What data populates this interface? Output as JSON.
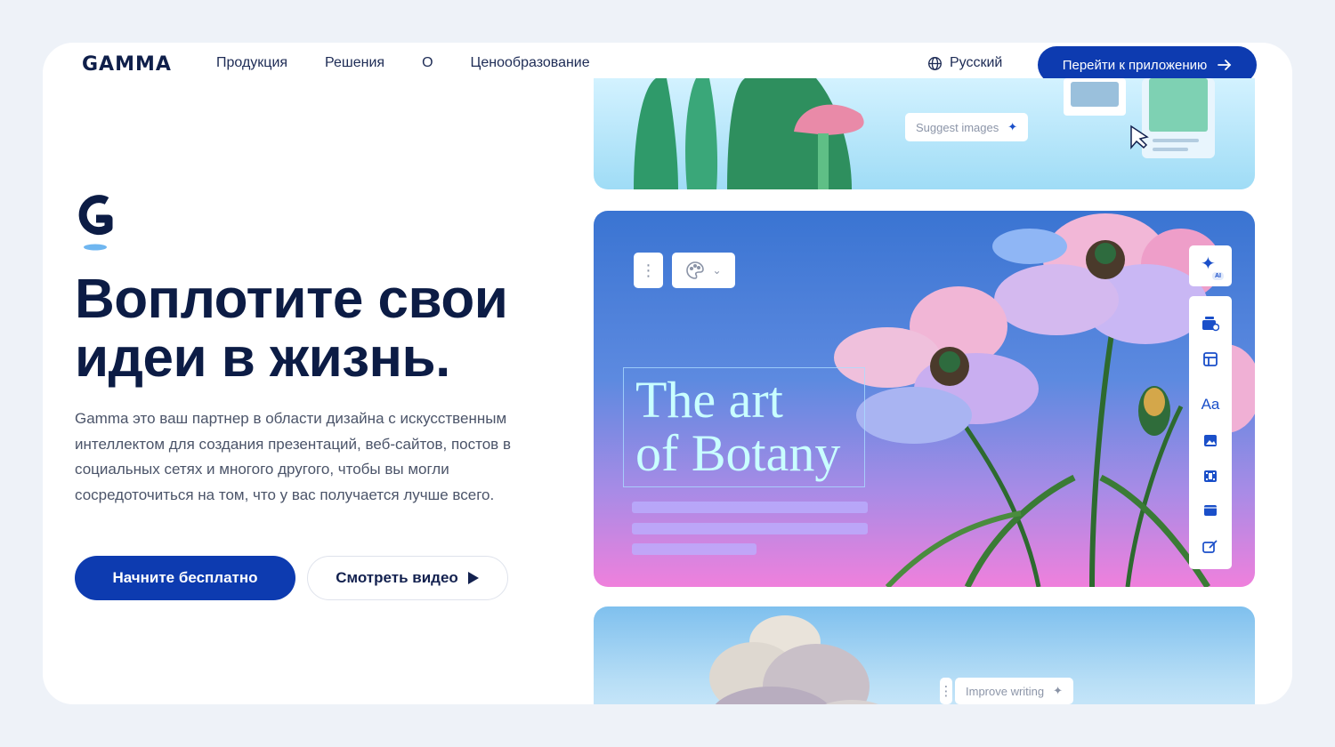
{
  "header": {
    "logo": "GAMMA",
    "nav": [
      "Продукция",
      "Решения",
      "О",
      "Ценообразование"
    ],
    "language": "Русский",
    "app_button": "Перейти к приложению"
  },
  "hero": {
    "title_line1": "Воплотите свои",
    "title_line2": "идеи в жизнь.",
    "description": "Gamma это ваш партнер в области дизайна с искусственным интеллектом для создания презентаций, веб-сайтов, постов в социальных сетях и многого другого, чтобы вы могли сосредоточиться на том, что у вас получается лучше всего.",
    "primary_button": "Начните бесплатно",
    "secondary_button": "Смотреть видео"
  },
  "preview": {
    "suggest_images": "Suggest images",
    "art_title_line1": "The art",
    "art_title_line2": "of Botany",
    "ai_badge": "AI",
    "text_tool": "Aa",
    "improve_writing": "Improve writing",
    "side_tools": [
      "cards-icon",
      "layout-icon",
      "text-icon",
      "image-icon",
      "video-icon",
      "block-icon",
      "edit-icon"
    ]
  },
  "colors": {
    "brand": "#0d3bb0",
    "heading": "#0c1c45",
    "page_bg": "#eef2f8"
  }
}
